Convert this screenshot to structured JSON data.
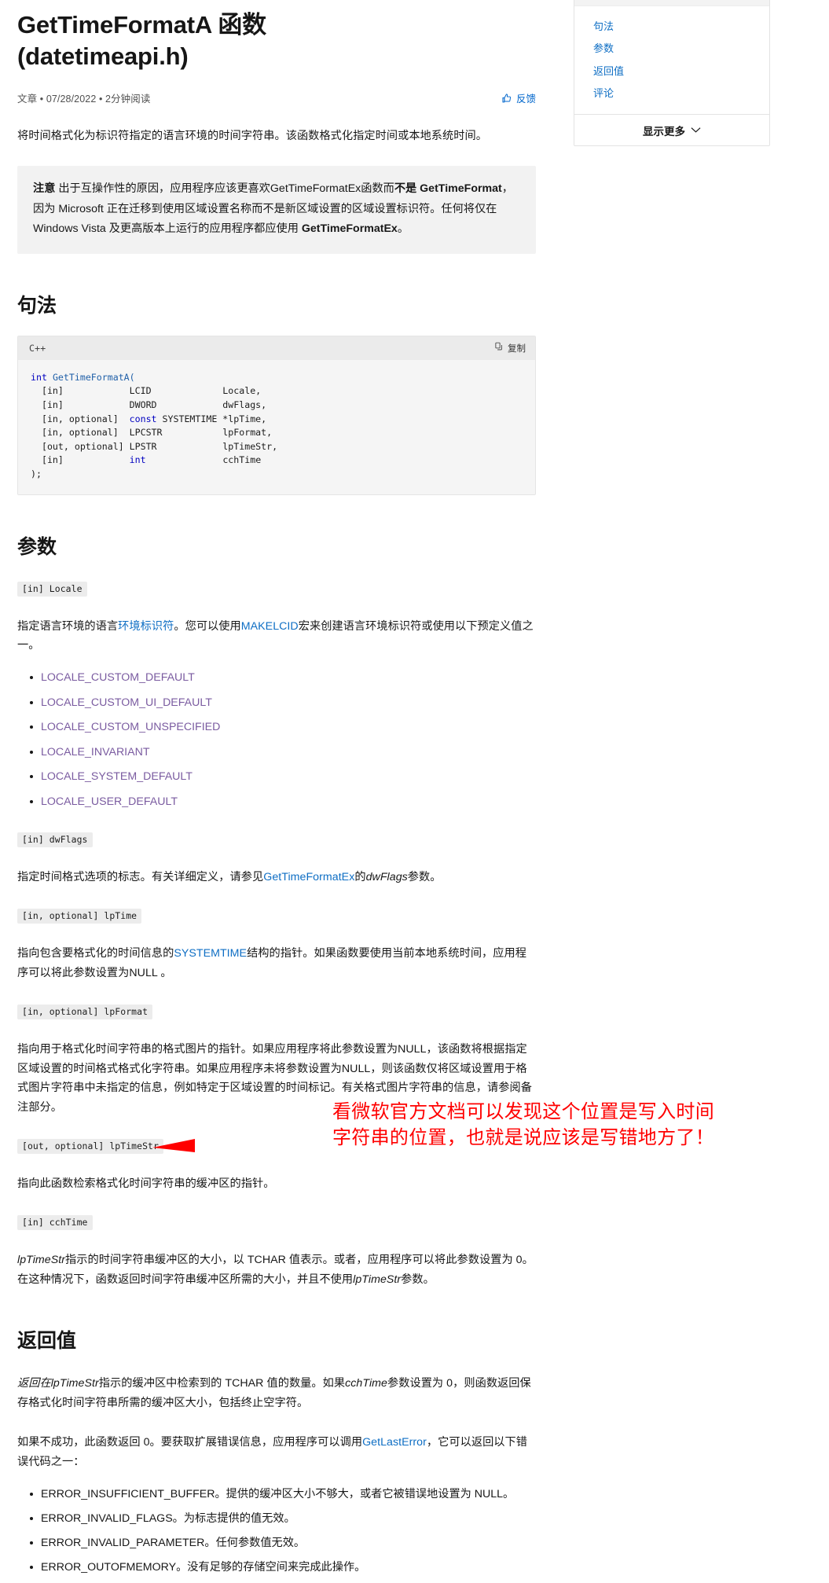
{
  "article": {
    "title_line1": "GetTimeFormatA 函数",
    "title_line2": "(datetimeapi.h)",
    "meta": "文章 • 07/28/2022 • 2分钟阅读",
    "feedback_label": "反馈",
    "intro": "将时间格式化为标识符指定的语言环境的时间字符串。该函数格式化指定时间或本地系统时间。",
    "note": {
      "label": "注意",
      "text_1": " 出于互操作性的原因，应用程序应该更喜欢GetTimeFormatEx函数而",
      "bold_1": "不是 GetTimeFormat",
      "text_2": "，因为 Microsoft 正在迁移到使用区域设置名称而不是新区域设置的区域设置标识符。任何将仅在 Windows Vista 及更高版本上运行的应用程序都应使用 ",
      "bold_2": "GetTimeFormatEx",
      "text_3": "。"
    }
  },
  "syntax": {
    "heading": "句法",
    "language": "C++",
    "copy_label": "复制",
    "code": "int GetTimeFormatA(\n  [in]            LCID             Locale,\n  [in]            DWORD            dwFlags,\n  [in, optional]  const SYSTEMTIME *lpTime,\n  [in, optional]  LPCSTR           lpFormat,\n  [out, optional] LPSTR            lpTimeStr,\n  [in]            int              cchTime\n);",
    "code_tokens": {
      "keyword_int": "int",
      "fn_name": "GetTimeFormatA(",
      "keyword_const": "const",
      "keyword_int2": "int"
    }
  },
  "parameters": {
    "heading": "参数",
    "items": [
      {
        "chip": "[in] Locale",
        "desc_parts": [
          {
            "type": "text",
            "value": "指定语言环境的语言"
          },
          {
            "type": "link",
            "value": "环境标识符"
          },
          {
            "type": "text",
            "value": "。您可以使用"
          },
          {
            "type": "link",
            "value": "MAKELCID"
          },
          {
            "type": "text",
            "value": "宏来创建语言环境标识符或使用以下预定义值之一。"
          }
        ],
        "list": [
          "LOCALE_CUSTOM_DEFAULT",
          "LOCALE_CUSTOM_UI_DEFAULT",
          "LOCALE_CUSTOM_UNSPECIFIED",
          "LOCALE_INVARIANT",
          "LOCALE_SYSTEM_DEFAULT",
          "LOCALE_USER_DEFAULT"
        ]
      },
      {
        "chip": "[in] dwFlags",
        "desc_parts": [
          {
            "type": "text",
            "value": "指定时间格式选项的标志。有关详细定义，请参见"
          },
          {
            "type": "link",
            "value": "GetTimeFormatEx"
          },
          {
            "type": "text",
            "value": "的"
          },
          {
            "type": "italic",
            "value": "dwFlags"
          },
          {
            "type": "text",
            "value": "参数。"
          }
        ],
        "list": []
      },
      {
        "chip": "[in, optional] lpTime",
        "desc_parts": [
          {
            "type": "text",
            "value": "指向包含要格式化的时间信息的"
          },
          {
            "type": "link",
            "value": "SYSTEMTIME"
          },
          {
            "type": "text",
            "value": "结构的指针。如果函数要使用当前本地系统时间，应用程序可以将此参数设置为NULL 。"
          }
        ],
        "list": []
      },
      {
        "chip": "[in, optional] lpFormat",
        "desc_parts": [
          {
            "type": "text",
            "value": "指向用于格式化时间字符串的格式图片的指针。如果应用程序将此参数设置为NULL，该函数将根据指定区域设置的时间格式格式化字符串。如果应用程序未将参数设置为NULL，则该函数仅将区域设置用于格式图片字符串中未指定的信息，例如特定于区域设置的时间标记。有关格式图片字符串的信息，请参阅备注部分。"
          }
        ],
        "list": []
      },
      {
        "chip": "[out, optional] lpTimeStr",
        "desc_parts": [
          {
            "type": "text",
            "value": "指向此函数检索格式化时间字符串的缓冲区的指针。"
          }
        ],
        "list": []
      },
      {
        "chip": "[in] cchTime",
        "desc_parts": [
          {
            "type": "italic",
            "value": "lpTimeStr"
          },
          {
            "type": "text",
            "value": "指示的时间字符串缓冲区的大小，以 TCHAR 值表示。或者，应用程序可以将此参数设置为 0。在这种情况下，函数返回时间字符串缓冲区所需的大小，并且不使用"
          },
          {
            "type": "italic",
            "value": "lpTimeStr"
          },
          {
            "type": "text",
            "value": "参数。"
          }
        ],
        "list": []
      }
    ]
  },
  "return_value": {
    "heading": "返回值",
    "para1_parts": [
      {
        "type": "italic",
        "value": "返回在lpTimeStr"
      },
      {
        "type": "text",
        "value": "指示的缓冲区中检索到的 TCHAR 值的数量。如果"
      },
      {
        "type": "italic",
        "value": "cchTime"
      },
      {
        "type": "text",
        "value": "参数设置为 0，则函数返回保存格式化时间字符串所需的缓冲区大小，包括终止空字符。"
      }
    ],
    "para2_parts": [
      {
        "type": "text",
        "value": "如果不成功，此函数返回 0。要获取扩展错误信息，应用程序可以调用"
      },
      {
        "type": "link",
        "value": "GetLastError"
      },
      {
        "type": "text",
        "value": "，它可以返回以下错误代码之一："
      }
    ],
    "errors": [
      "ERROR_INSUFFICIENT_BUFFER。提供的缓冲区大小不够大，或者它被错误地设置为 NULL。",
      "ERROR_INVALID_FLAGS。为标志提供的值无效。",
      "ERROR_INVALID_PARAMETER。任何参数值无效。",
      "ERROR_OUTOFMEMORY。没有足够的存储空间来完成此操作。"
    ]
  },
  "toc": {
    "items": [
      "句法",
      "参数",
      "返回值",
      "评论"
    ],
    "show_more_label": "显示更多"
  },
  "annotation": {
    "line1": "看微软官方文档可以发现这个位置是写入时间",
    "line2": "字符串的位置，也就是说应该是写错地方了！",
    "color": "#ff0000"
  },
  "colors": {
    "link": "#0e6ec4",
    "link_visited": "#7a5ba0",
    "note_bg": "#f2f2f2",
    "code_bg": "#f5f5f5",
    "code_head_bg": "#ebebeb",
    "chip_bg": "#ececec",
    "annotation_red": "#ff0000"
  }
}
